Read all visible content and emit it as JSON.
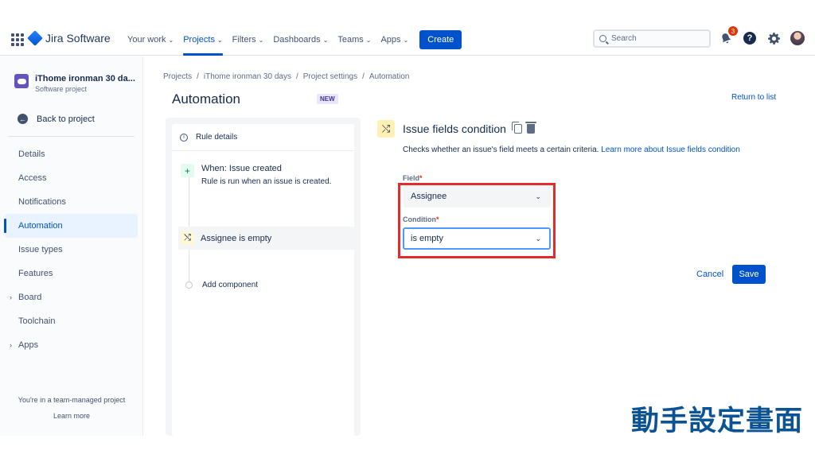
{
  "topnav": {
    "product": "Jira Software",
    "items": [
      {
        "label": "Your work",
        "dropdown": true
      },
      {
        "label": "Projects",
        "dropdown": true,
        "active": true
      },
      {
        "label": "Filters",
        "dropdown": true
      },
      {
        "label": "Dashboards",
        "dropdown": true
      },
      {
        "label": "Teams",
        "dropdown": true
      },
      {
        "label": "Apps",
        "dropdown": true
      }
    ],
    "create_label": "Create",
    "search_placeholder": "Search",
    "notification_count": "3"
  },
  "sidebar": {
    "project_name": "iThome ironman 30 da...",
    "project_type": "Software project",
    "back_label": "Back to project",
    "items": [
      {
        "label": "Details"
      },
      {
        "label": "Access"
      },
      {
        "label": "Notifications"
      },
      {
        "label": "Automation"
      },
      {
        "label": "Issue types"
      },
      {
        "label": "Features"
      },
      {
        "label": "Board"
      },
      {
        "label": "Toolchain"
      },
      {
        "label": "Apps"
      }
    ],
    "footer_text": "You're in a team-managed project",
    "footer_link": "Learn more"
  },
  "breadcrumb": [
    "Projects",
    "/",
    "iThome ironman 30 days",
    "/",
    "Project settings",
    "/",
    "Automation"
  ],
  "page": {
    "title": "Automation",
    "new_badge": "NEW",
    "return_link": "Return to list"
  },
  "rule": {
    "details_label": "Rule details",
    "trigger_title": "When: Issue created",
    "trigger_desc": "Rule is run when an issue is created.",
    "condition_label": "Assignee is empty",
    "add_component": "Add component"
  },
  "editor": {
    "title": "Issue fields condition",
    "desc_text": "Checks whether an issue's field meets a certain criteria.",
    "desc_link": "Learn more about Issue fields condition",
    "field_label": "Field",
    "field_value": "Assignee",
    "condition_label": "Condition",
    "condition_value": "is empty",
    "required_mark": "*",
    "cancel_label": "Cancel",
    "save_label": "Save"
  },
  "caption": "動手設定畫面",
  "colors": {
    "brand": "#0052cc",
    "highlight_box": "#e32b2b",
    "caption": "#0b5394"
  }
}
